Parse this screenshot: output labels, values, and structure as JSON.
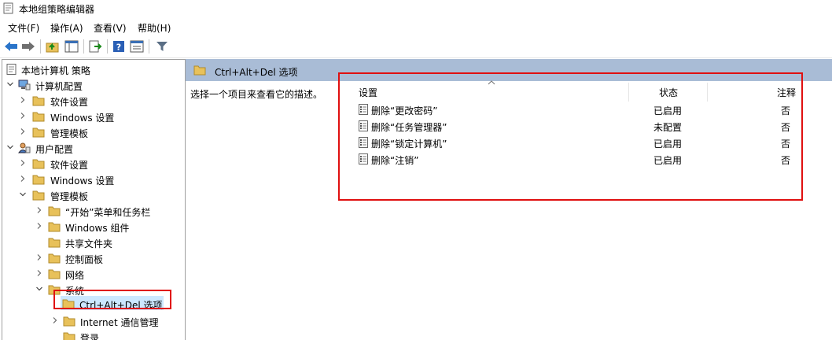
{
  "window": {
    "title": "本地组策略编辑器"
  },
  "menu": {
    "file": "文件(F)",
    "action": "操作(A)",
    "view": "查看(V)",
    "help": "帮助(H)"
  },
  "toolbar": {
    "icons": [
      "back-icon",
      "forward-icon",
      "up-folder-icon",
      "show-hide-tree-icon",
      "export-list-icon",
      "help-icon",
      "properties-icon",
      "filter-icon"
    ]
  },
  "tree": {
    "root": "本地计算机 策略",
    "computer_config": "计算机配置",
    "cc_software": "软件设置",
    "cc_windows": "Windows 设置",
    "cc_admin": "管理模板",
    "user_config": "用户配置",
    "uc_software": "软件设置",
    "uc_windows": "Windows 设置",
    "uc_admin": "管理模板",
    "start_menu": "“开始”菜单和任务栏",
    "windows_components": "Windows 组件",
    "shared_folders": "共享文件夹",
    "control_panel": "控制面板",
    "network": "网络",
    "system": "系统",
    "cad_options": "Ctrl+Alt+Del 选项",
    "internet_comm": "Internet 通信管理",
    "logon": "登录"
  },
  "right": {
    "header_title": "Ctrl+Alt+Del 选项",
    "description": "选择一个项目来查看它的描述。",
    "columns": {
      "setting": "设置",
      "state": "状态",
      "comment": "注释"
    },
    "rows": [
      {
        "name": "删除“更改密码”",
        "state": "已启用",
        "comment": "否"
      },
      {
        "name": "删除“任务管理器”",
        "state": "未配置",
        "comment": "否"
      },
      {
        "name": "删除“锁定计算机”",
        "state": "已启用",
        "comment": "否"
      },
      {
        "name": "删除“注销”",
        "state": "已启用",
        "comment": "否"
      }
    ]
  },
  "colors": {
    "header_bg": "#a9bcd6",
    "highlight": "#e01010",
    "selected": "#cce8ff",
    "folder": "#e8c15a"
  }
}
